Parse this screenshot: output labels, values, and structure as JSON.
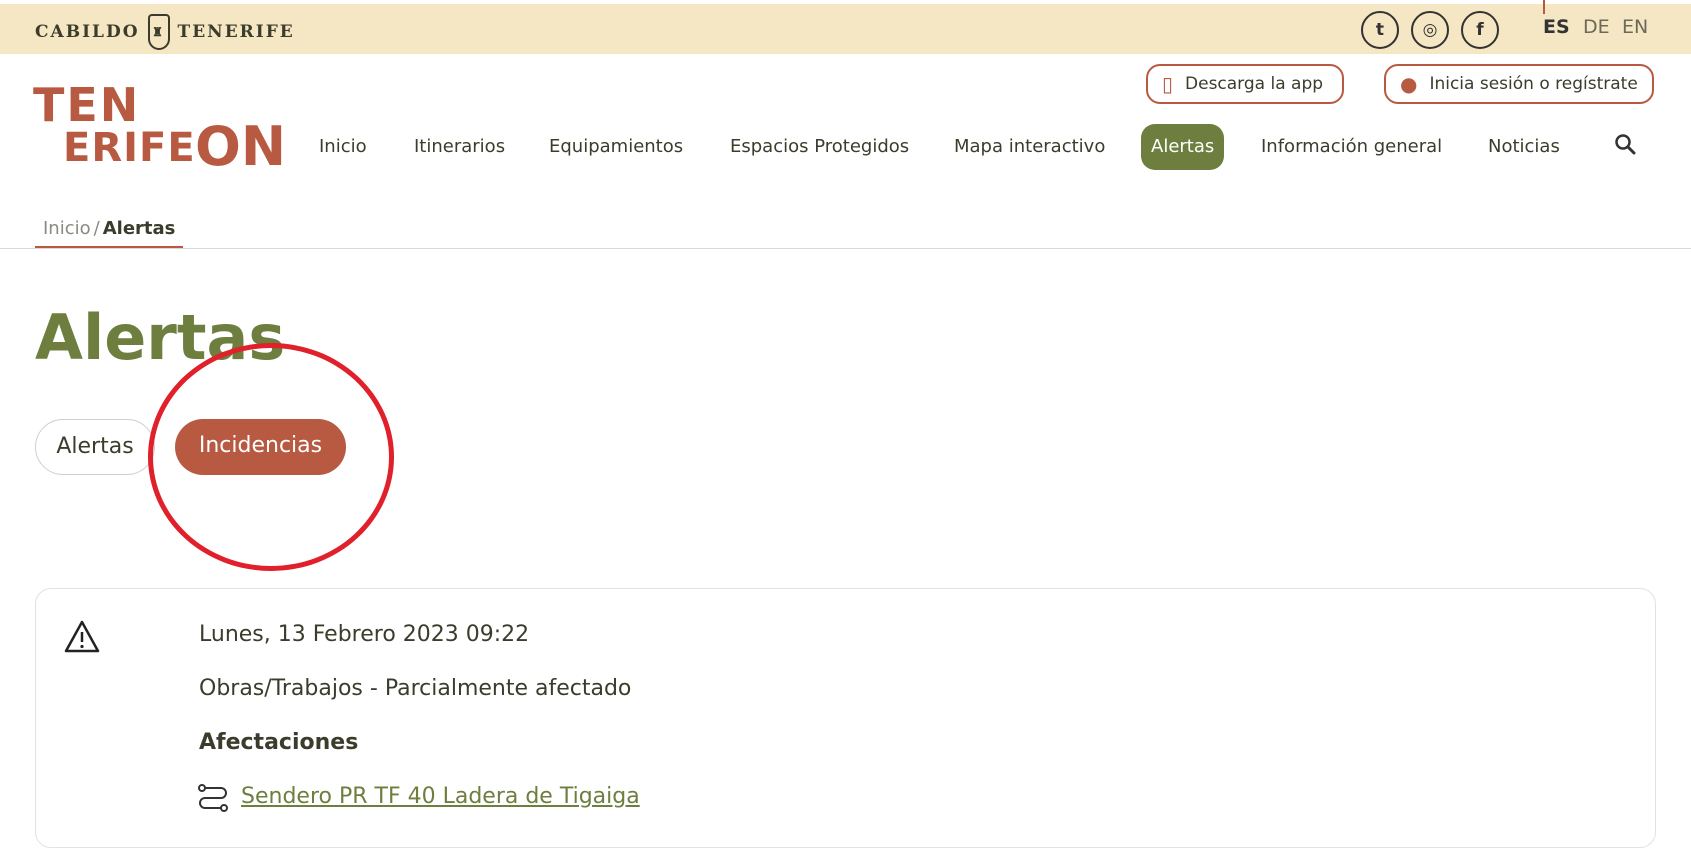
{
  "topbar": {
    "brand_left": "CABILDO",
    "brand_right": "TENERIFE",
    "social": [
      {
        "icon": "twitter-icon",
        "glyph": "t"
      },
      {
        "icon": "instagram-icon",
        "glyph": "◎"
      },
      {
        "icon": "facebook-icon",
        "glyph": "f"
      }
    ],
    "languages": [
      "ES",
      "DE",
      "EN"
    ],
    "active_language": "ES"
  },
  "header": {
    "logo": {
      "line1": "TEN",
      "line2": "ERIFE",
      "line3": "ON"
    },
    "download_app": "Descarga la app",
    "login": "Inicia sesión o regístrate",
    "nav": [
      "Inicio",
      "Itinerarios",
      "Equipamientos",
      "Espacios Protegidos",
      "Mapa interactivo",
      "Alertas",
      "Información general",
      "Noticias"
    ],
    "active_nav": "Alertas"
  },
  "breadcrumb": {
    "home": "Inicio",
    "separator": "/",
    "current": "Alertas"
  },
  "main": {
    "title": "Alertas",
    "tabs": [
      {
        "label": "Alertas",
        "selected": false
      },
      {
        "label": "Incidencias",
        "selected": true
      }
    ]
  },
  "alert_card": {
    "date": "Lunes, 13 Febrero 2023 09:22",
    "type": "Obras/Trabajos - Parcialmente afectado",
    "affections_heading": "Afectaciones",
    "affected_route": "Sendero PR TF 40 Ladera de Tigaiga"
  },
  "colors": {
    "topbar_bg": "#f5e6c4",
    "brand_terracotta": "#b85a41",
    "brand_green": "#6d7e3e",
    "annotation_red": "#e0202a"
  }
}
